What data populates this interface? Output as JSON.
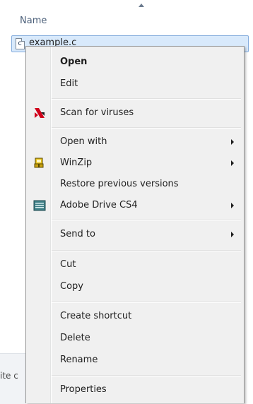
{
  "explorer": {
    "column_header": "Name",
    "file_name": "example.c",
    "file_icon_glyph": "c",
    "bottom_left_text": "ite c"
  },
  "context_menu": {
    "items": [
      {
        "label": "Open",
        "bold": true,
        "icon": "",
        "submenu": false
      },
      {
        "label": "Edit",
        "bold": false,
        "icon": "",
        "submenu": false
      },
      {
        "label": "Scan for viruses",
        "bold": false,
        "icon": "kaspersky-icon",
        "submenu": false
      },
      {
        "label": "Open with",
        "bold": false,
        "icon": "",
        "submenu": true
      },
      {
        "label": "WinZip",
        "bold": false,
        "icon": "winzip-icon",
        "submenu": true
      },
      {
        "label": "Restore previous versions",
        "bold": false,
        "icon": "",
        "submenu": false
      },
      {
        "label": "Adobe Drive CS4",
        "bold": false,
        "icon": "adobe-drive-icon",
        "submenu": true
      },
      {
        "label": "Send to",
        "bold": false,
        "icon": "",
        "submenu": true
      },
      {
        "label": "Cut",
        "bold": false,
        "icon": "",
        "submenu": false
      },
      {
        "label": "Copy",
        "bold": false,
        "icon": "",
        "submenu": false
      },
      {
        "label": "Create shortcut",
        "bold": false,
        "icon": "",
        "submenu": false
      },
      {
        "label": "Delete",
        "bold": false,
        "icon": "",
        "submenu": false
      },
      {
        "label": "Rename",
        "bold": false,
        "icon": "",
        "submenu": false
      },
      {
        "label": "Properties",
        "bold": false,
        "icon": "",
        "submenu": false
      }
    ]
  },
  "colors": {
    "menu_background": "#f0f0f0",
    "menu_border": "#979797",
    "selection_background": "#d8e9fb",
    "selection_border": "#84acdd",
    "kaspersky_red": "#d0021b",
    "winzip_yellow": "#e8c21a",
    "adobe_drive_teal": "#3f7f86"
  }
}
